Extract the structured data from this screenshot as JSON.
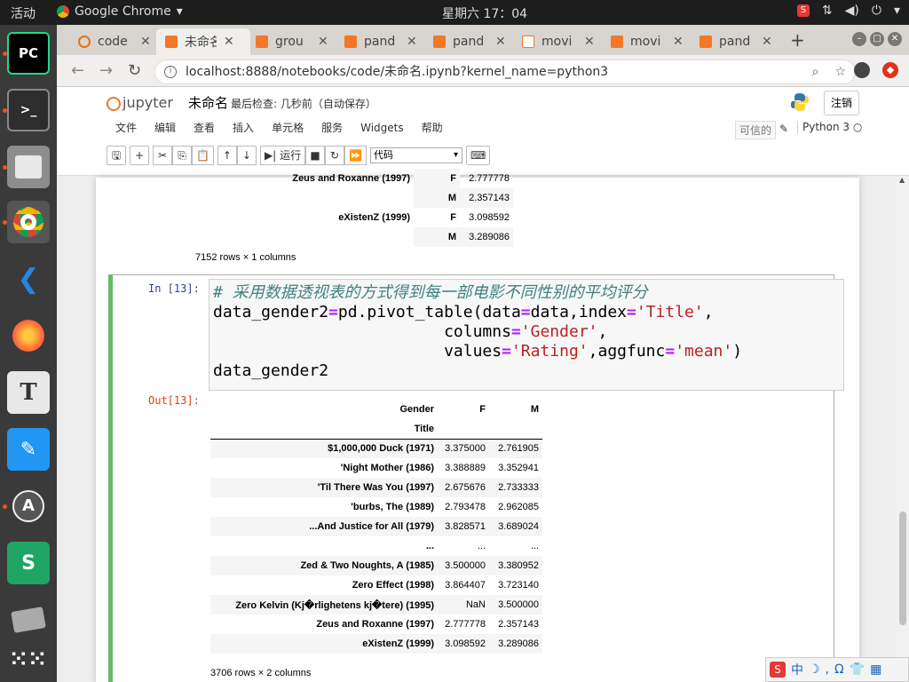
{
  "system": {
    "activities": "活动",
    "app_name": "Google Chrome",
    "clock": "星期六 17：04",
    "tray_icons": [
      "sogou-icon",
      "network-icon",
      "volume-icon",
      "power-icon",
      "chevron-down-icon"
    ]
  },
  "dock": {
    "apps": [
      "pycharm-icon",
      "terminal-icon",
      "files-icon",
      "chrome-icon",
      "vscode-icon",
      "firefox-icon",
      "typora-icon",
      "qq-icon",
      "software-updater-icon",
      "wps-sheets-icon",
      "keyboard-icon",
      "app-grid-icon"
    ]
  },
  "browser": {
    "tabs": [
      {
        "label": "code",
        "color": "#e8710a"
      },
      {
        "label": "未命名",
        "color": "#f37726"
      },
      {
        "label": "grou",
        "color": "#f37726"
      },
      {
        "label": "pand",
        "color": "#f37726"
      },
      {
        "label": "pand",
        "color": "#f37726"
      },
      {
        "label": "movi",
        "color": "#f37726"
      },
      {
        "label": "movi",
        "color": "#f37726"
      },
      {
        "label": "pand",
        "color": "#f37726"
      }
    ],
    "new_tab": "+",
    "url": "localhost:8888/notebooks/code/未命名.ipynb?kernel_name=python3"
  },
  "jupyter": {
    "logo_text": "jupyter",
    "notebook_name": "未命名",
    "checkpoint": "最后检查: 几秒前（自动保存）",
    "logout": "注销",
    "menu": [
      "文件",
      "编辑",
      "查看",
      "插入",
      "单元格",
      "服务",
      "Widgets",
      "帮助"
    ],
    "trusted": "可信的",
    "kernel": "Python 3",
    "run_label": "运行",
    "cell_type": "代码"
  },
  "prev_output": {
    "rows": [
      {
        "title": "Zeus and Roxanne (1997)",
        "gender": "F",
        "value": "2.777778"
      },
      {
        "title": "",
        "gender": "M",
        "value": "2.357143"
      },
      {
        "title": "eXistenZ (1999)",
        "gender": "F",
        "value": "3.098592"
      },
      {
        "title": "",
        "gender": "M",
        "value": "3.289086"
      }
    ],
    "summary": "7152 rows × 1 columns"
  },
  "cell": {
    "in_prompt": "In [13]:",
    "out_prompt": "Out[13]:",
    "code": {
      "comment": "# 采用数据透视表的方式得到每一部电影不同性别的平均评分",
      "l2a": "data_gender2",
      "l2b": "pd.pivot_table(data",
      "l2c": "data,index",
      "l2d": "'Title'",
      "l2e": ",",
      "l3a": "                        columns",
      "l3b": "'Gender'",
      "l3c": ",",
      "l4a": "                        values",
      "l4b": "'Rating'",
      "l4c": ",aggfunc",
      "l4d": "'mean'",
      "l4e": ")",
      "l5": "data_gender2",
      "eq": "="
    },
    "table": {
      "header_gender": "Gender",
      "header_f": "F",
      "header_m": "M",
      "header_title": "Title",
      "rows": [
        {
          "title": "$1,000,000 Duck (1971)",
          "f": "3.375000",
          "m": "2.761905"
        },
        {
          "title": "'Night Mother (1986)",
          "f": "3.388889",
          "m": "3.352941"
        },
        {
          "title": "'Til There Was You (1997)",
          "f": "2.675676",
          "m": "2.733333"
        },
        {
          "title": "'burbs, The (1989)",
          "f": "2.793478",
          "m": "2.962085"
        },
        {
          "title": "...And Justice for All (1979)",
          "f": "3.828571",
          "m": "3.689024"
        },
        {
          "title": "...",
          "f": "...",
          "m": "..."
        },
        {
          "title": "Zed & Two Noughts, A (1985)",
          "f": "3.500000",
          "m": "3.380952"
        },
        {
          "title": "Zero Effect (1998)",
          "f": "3.864407",
          "m": "3.723140"
        },
        {
          "title": "Zero Kelvin (Kj�rlighetens kj�tere) (1995)",
          "f": "NaN",
          "m": "3.500000"
        },
        {
          "title": "Zeus and Roxanne (1997)",
          "f": "2.777778",
          "m": "2.357143"
        },
        {
          "title": "eXistenZ (1999)",
          "f": "3.098592",
          "m": "3.289086"
        }
      ],
      "summary": "3706 rows × 2 columns"
    }
  },
  "ime": {
    "label": "中",
    "icons": [
      "moon-icon",
      "comma-icon",
      "omega-icon",
      "shirt-icon",
      "grid-icon"
    ]
  }
}
